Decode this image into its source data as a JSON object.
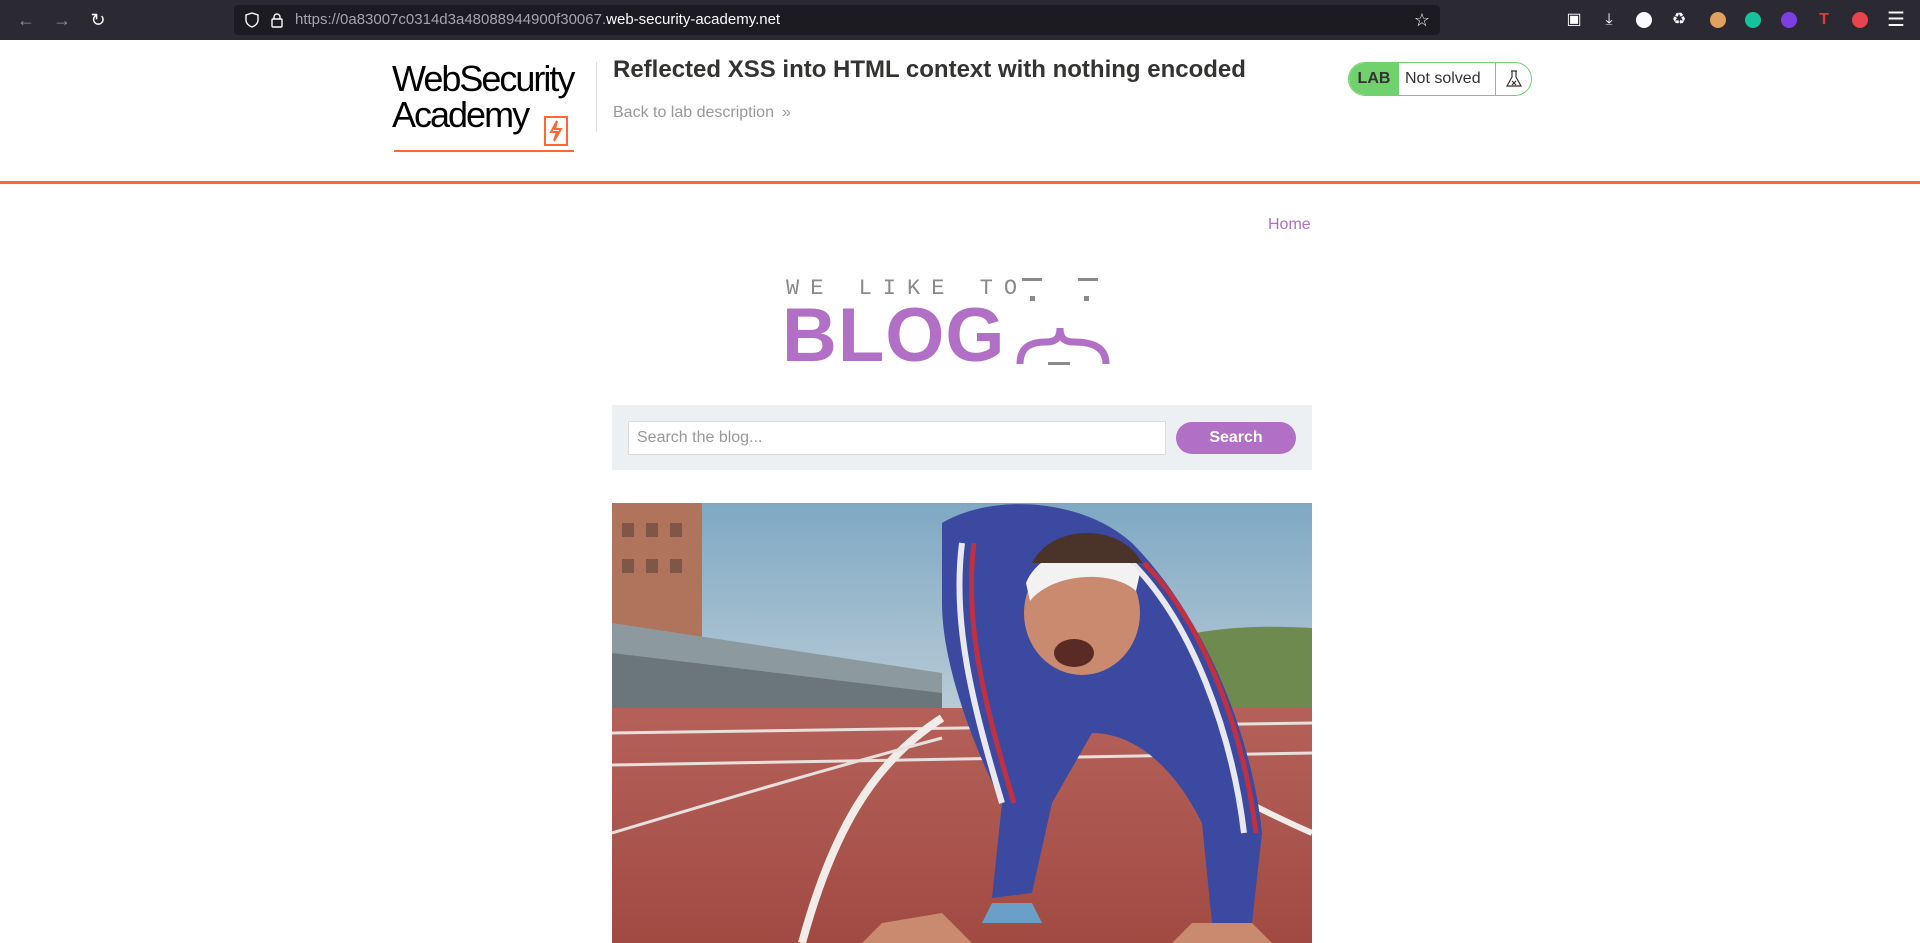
{
  "browser": {
    "url_prefix": "https://0a83007c0314d3a48088944900f30067.",
    "url_host": "web-security-academy.net",
    "icons": [
      "back-icon",
      "forward-icon",
      "reload-icon",
      "shield-icon",
      "lock-icon",
      "bookmark-star-icon",
      "pocket-icon",
      "download-icon",
      "extension-icon",
      "grammarly-icon",
      "app-menu-icon"
    ]
  },
  "lab": {
    "logo_line1": "WebSecurity",
    "logo_line2": "Academy",
    "title": "Reflected XSS into HTML context with nothing encoded",
    "back_link": "Back to lab description",
    "badge": "LAB",
    "status": "Not solved",
    "accent_color": "#ff6633",
    "status_color": "#70d16d"
  },
  "blog": {
    "home_link": "Home",
    "banner_tagline": "WE LIKE TO",
    "banner_word": "BLOG",
    "search_placeholder": "Search the blog...",
    "search_button": "Search",
    "accent_color": "#b16fc6"
  }
}
